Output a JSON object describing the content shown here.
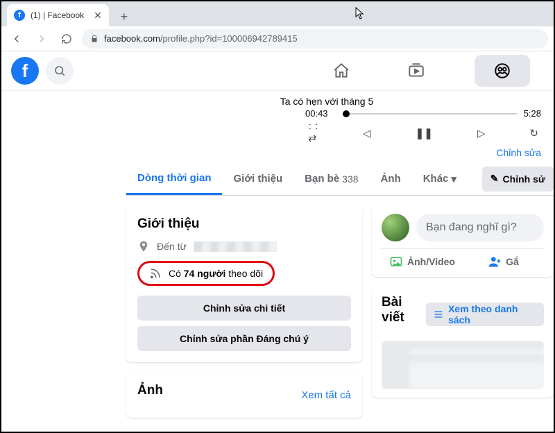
{
  "browser": {
    "tab_title": "(1)            | Facebook",
    "url_host": "facebook.com",
    "url_path": "/profile.php?id=100006942789415"
  },
  "player": {
    "title": "Ta có hẹn với tháng 5",
    "current_time": "00:43",
    "total_time": "5:28",
    "edit_label": "Chỉnh sửa"
  },
  "tabs": {
    "timeline": "Dòng thời gian",
    "about": "Giới thiệu",
    "friends": "Bạn bè",
    "friends_count": "338",
    "photos": "Ảnh",
    "more": "Khác",
    "edit_profile": "Chỉnh sử"
  },
  "intro": {
    "heading": "Giới thiệu",
    "from_label": "Đến từ",
    "followers_prefix": "Có",
    "followers_count": "74 người",
    "followers_suffix": "theo dõi",
    "edit_details": "Chỉnh sửa chi tiết",
    "edit_featured": "Chỉnh sửa phần Đáng chú ý"
  },
  "photos": {
    "heading": "Ảnh",
    "see_all": "Xem tất cả"
  },
  "composer": {
    "prompt": "Bạn đang nghĩ gì?",
    "photo_video": "Ảnh/Video",
    "tag": "Gắ"
  },
  "posts": {
    "heading": "Bài viết",
    "view_list": "Xem theo danh sách"
  }
}
